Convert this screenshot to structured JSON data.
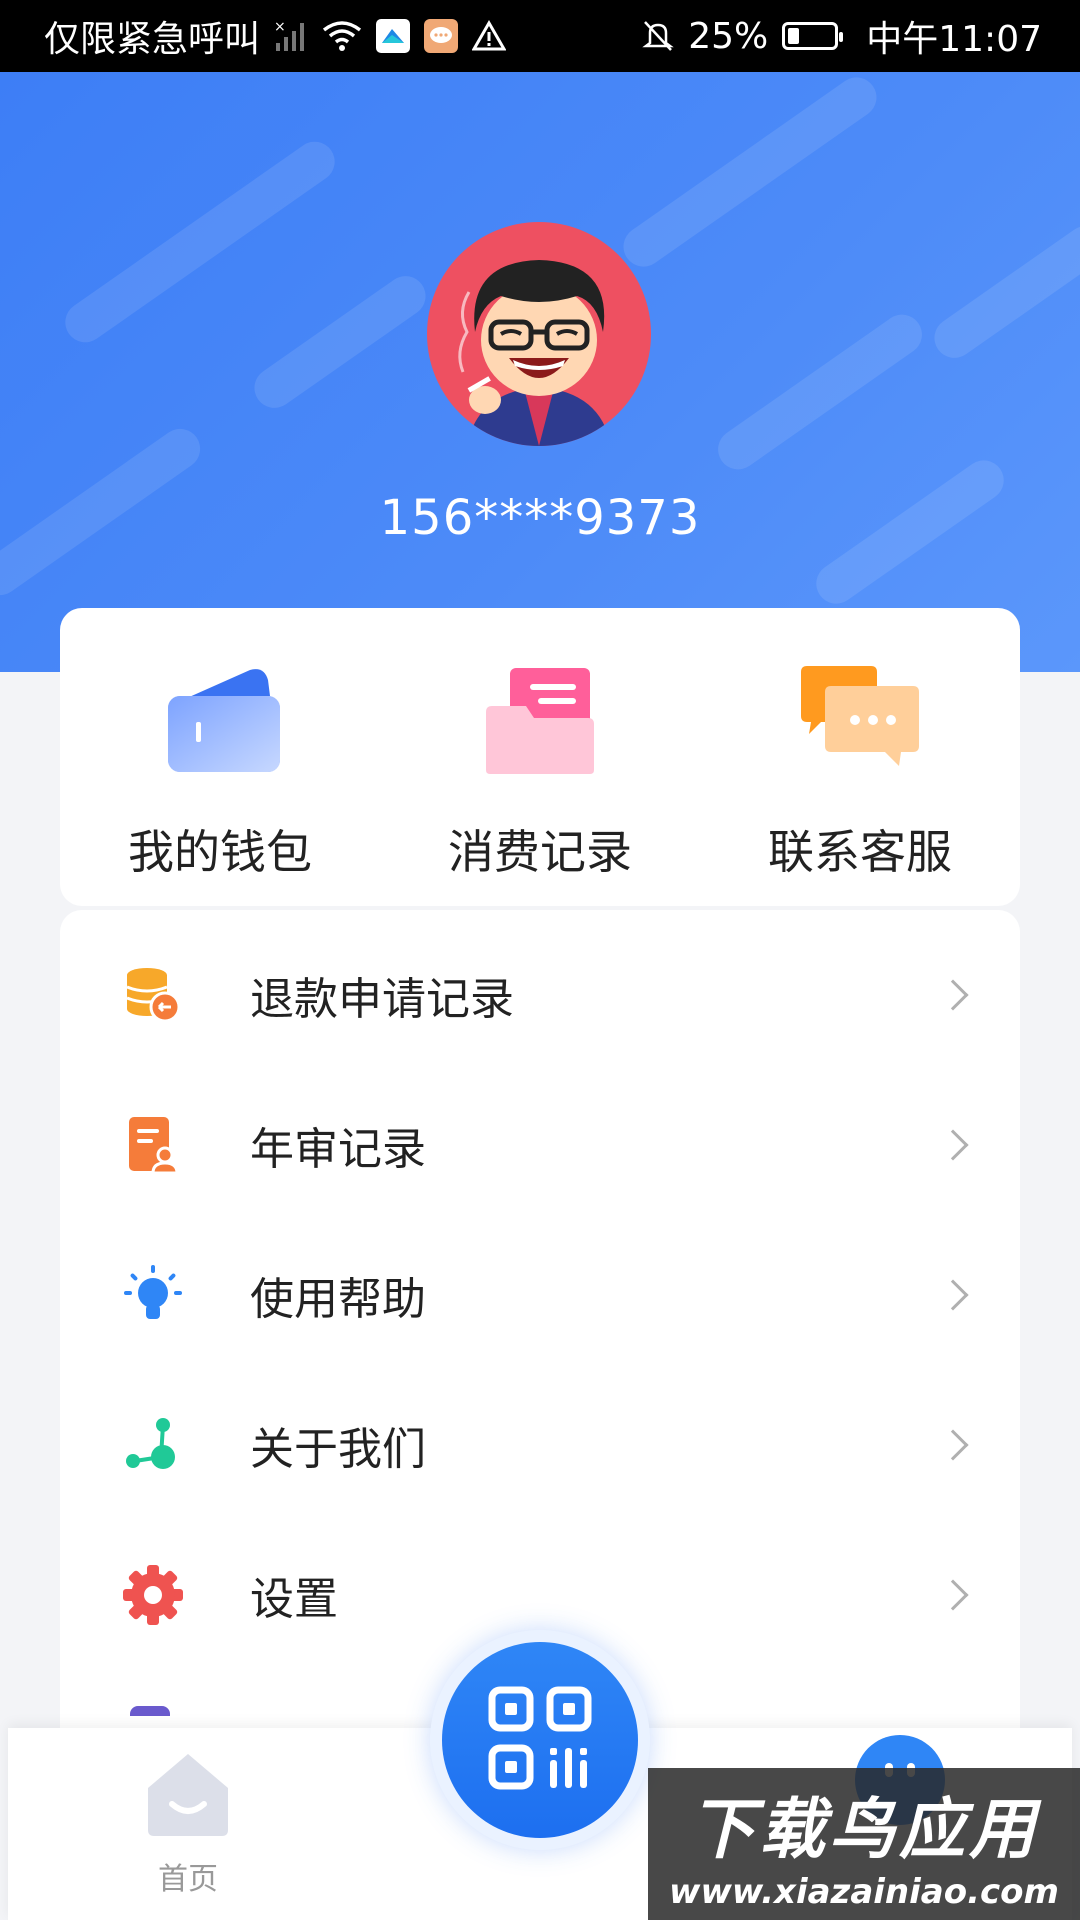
{
  "status_bar": {
    "carrier_text": "仅限紧急呼叫",
    "battery": "25%",
    "time": "中午11:07",
    "icons": [
      "no-signal-icon",
      "wifi-icon",
      "app-notification-icon",
      "message-icon",
      "warning-icon",
      "mute-icon",
      "battery-icon"
    ]
  },
  "profile": {
    "phone": "156****9373",
    "avatar": "cartoon-avatar"
  },
  "quick_actions": [
    {
      "label": "我的钱包",
      "icon": "wallet-icon"
    },
    {
      "label": "消费记录",
      "icon": "folder-icon"
    },
    {
      "label": "联系客服",
      "icon": "chat-icon"
    }
  ],
  "menu": [
    {
      "label": "退款申请记录",
      "icon": "refund-icon",
      "color": "#f7a82a"
    },
    {
      "label": "年审记录",
      "icon": "document-icon",
      "color": "#f57c3a"
    },
    {
      "label": "使用帮助",
      "icon": "lightbulb-icon",
      "color": "#2f86f6"
    },
    {
      "label": "关于我们",
      "icon": "network-icon",
      "color": "#20c997"
    },
    {
      "label": "设置",
      "icon": "gear-icon",
      "color": "#ef5350"
    }
  ],
  "bottom_nav": {
    "home_label": "首页",
    "scan_icon": "qr-scan-icon"
  },
  "watermark": {
    "title": "下载鸟应用",
    "url": "www.xiazainiao.com"
  },
  "colors": {
    "primary": "#3d7ef6",
    "header_gradient_end": "#5b97fb"
  }
}
